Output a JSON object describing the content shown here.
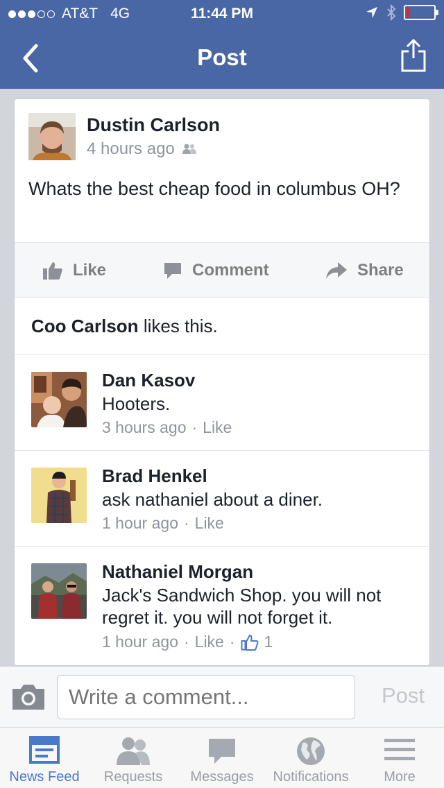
{
  "status_bar": {
    "carrier": "AT&T",
    "network": "4G",
    "time": "11:44 PM"
  },
  "nav": {
    "title": "Post",
    "back_icon": "chevron-left-icon",
    "share_icon": "share-upload-icon"
  },
  "post": {
    "author": "Dustin Carlson",
    "time": "4 hours ago",
    "audience_icon": "friends-icon",
    "text": "Whats the best cheap food in columbus OH?",
    "actions": {
      "like": "Like",
      "comment": "Comment",
      "share": "Share"
    },
    "likes": {
      "name": "Coo Carlson",
      "suffix": "likes this."
    }
  },
  "comments": [
    {
      "name": "Dan Kasov",
      "text": "Hooters.",
      "time": "3 hours ago",
      "dot": "·",
      "like": "Like",
      "like_count": ""
    },
    {
      "name": "Brad Henkel",
      "text": "ask nathaniel about a diner.",
      "time": "1 hour ago",
      "dot": "·",
      "like": "Like",
      "like_count": ""
    },
    {
      "name": "Nathaniel Morgan",
      "text": "Jack's Sandwich Shop. you will not regret it. you will not forget it.",
      "time": "1 hour ago",
      "dot": "·",
      "like": "Like",
      "like_count": "1"
    }
  ],
  "composer": {
    "placeholder": "Write a comment...",
    "post_label": "Post"
  },
  "tabs": [
    {
      "label": "News Feed",
      "icon": "news-feed-icon",
      "active": true
    },
    {
      "label": "Requests",
      "icon": "requests-icon",
      "active": false
    },
    {
      "label": "Messages",
      "icon": "messages-icon",
      "active": false
    },
    {
      "label": "Notifications",
      "icon": "globe-icon",
      "active": false
    },
    {
      "label": "More",
      "icon": "menu-icon",
      "active": false
    }
  ],
  "colors": {
    "brand_blue": "#4966a5",
    "active_tab": "#4a79c9"
  }
}
